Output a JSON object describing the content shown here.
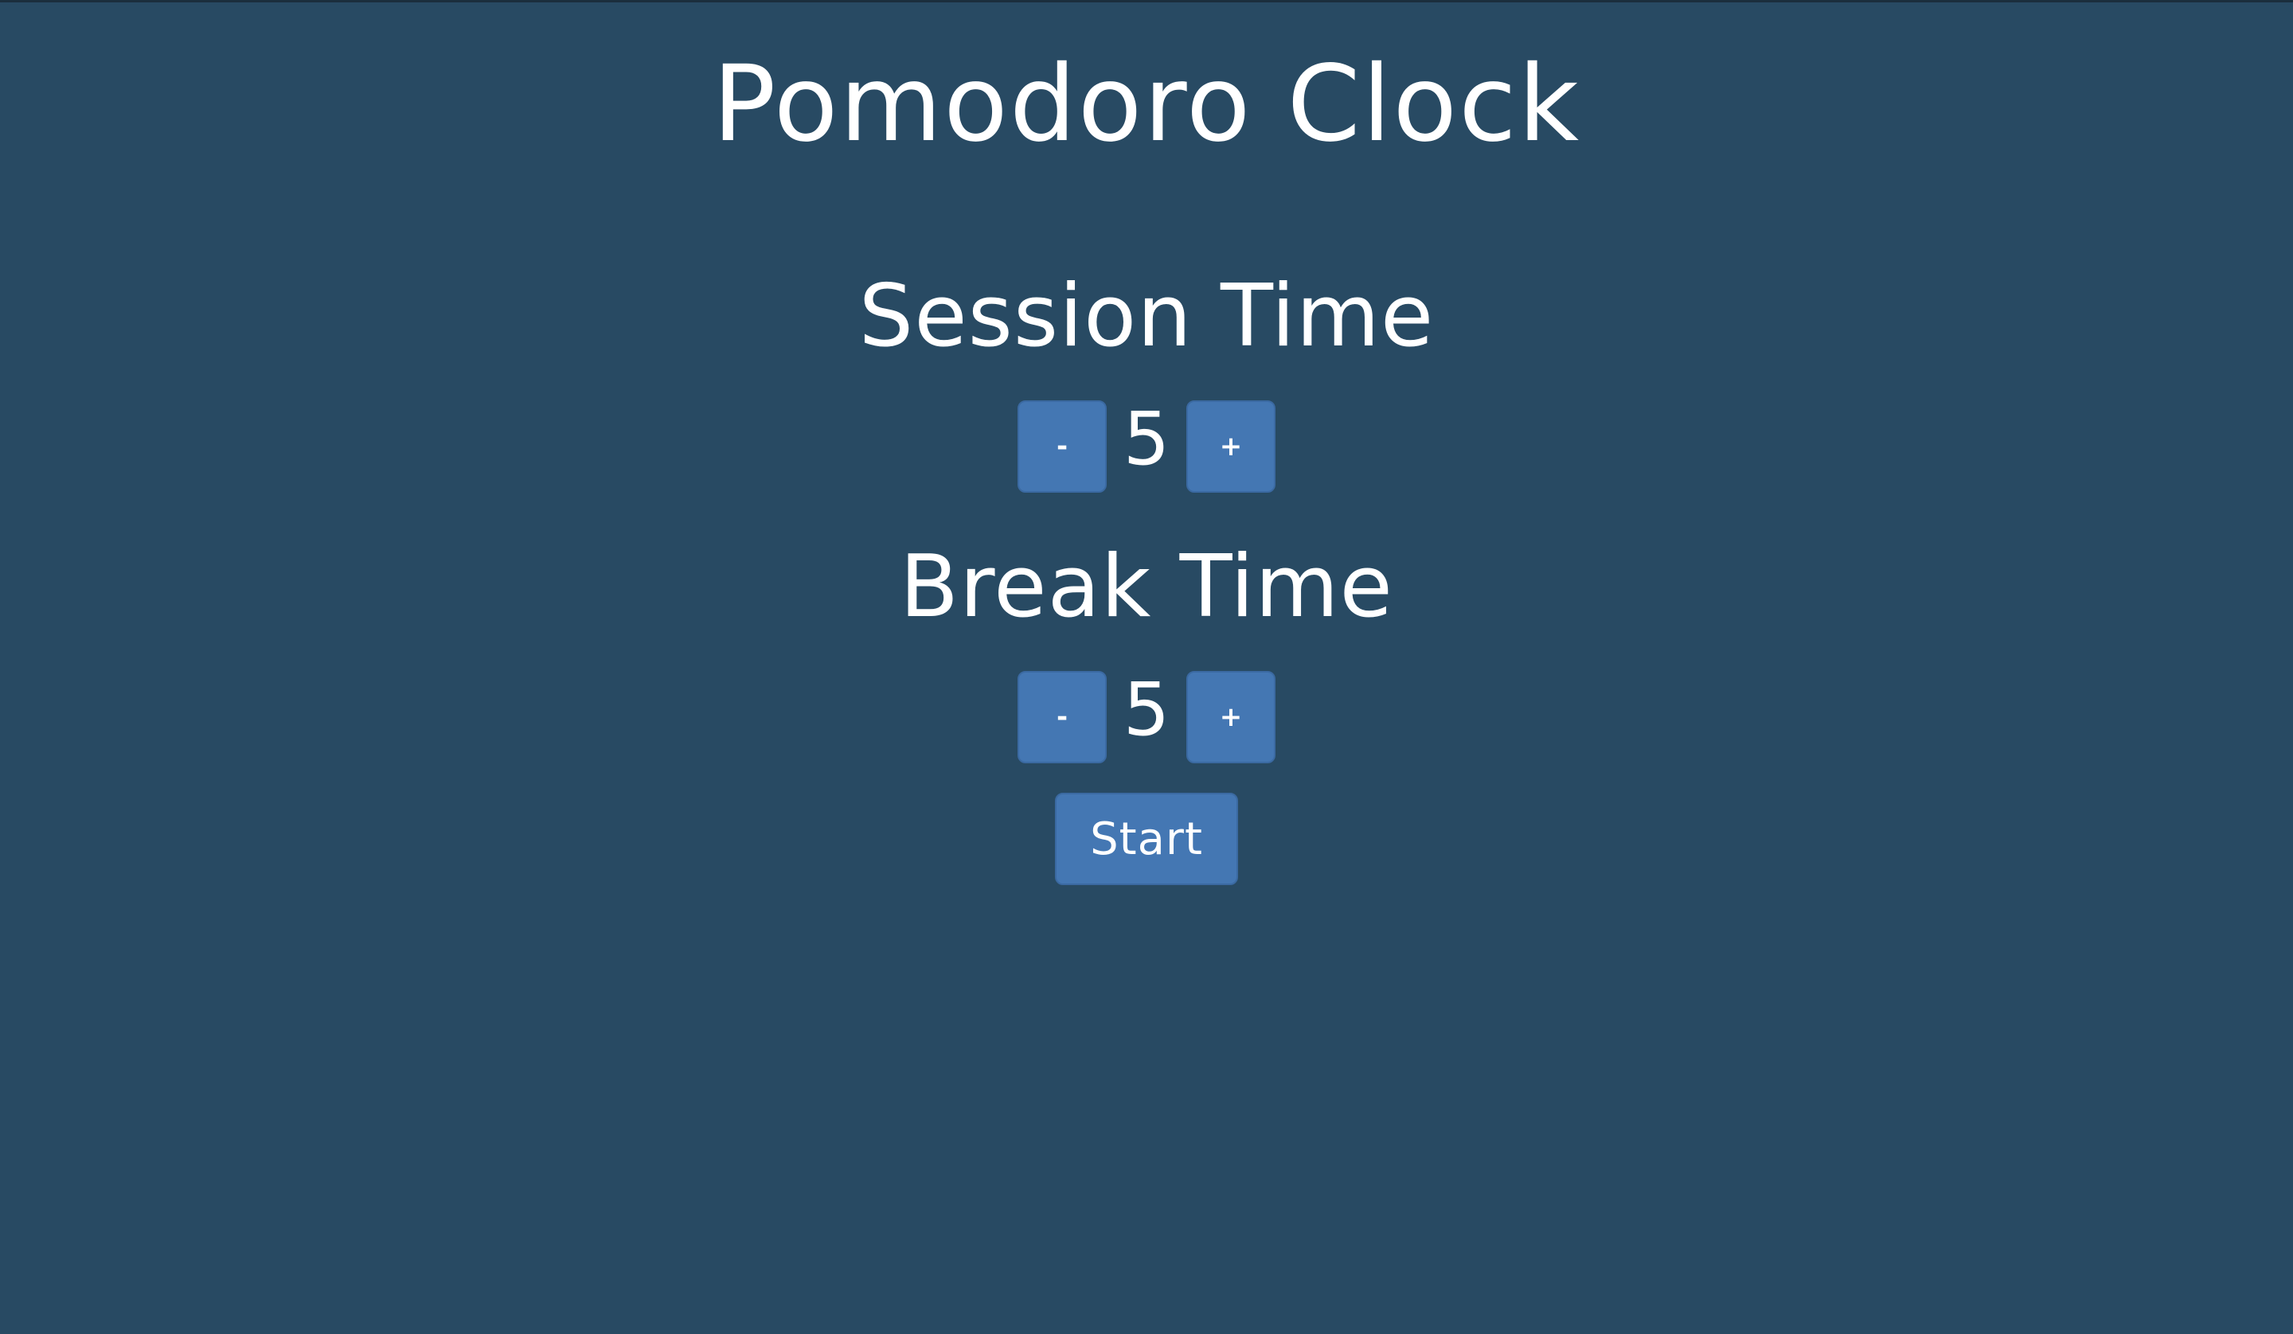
{
  "app": {
    "title": "Pomodoro Clock"
  },
  "session": {
    "heading": "Session Time",
    "decrement_label": "-",
    "value": "5",
    "increment_label": "+"
  },
  "break": {
    "heading": "Break Time",
    "decrement_label": "-",
    "value": "5",
    "increment_label": "+"
  },
  "controls": {
    "start_label": "Start"
  },
  "colors": {
    "background": "#284a63",
    "button": "#4477b3",
    "text": "#ffffff"
  }
}
